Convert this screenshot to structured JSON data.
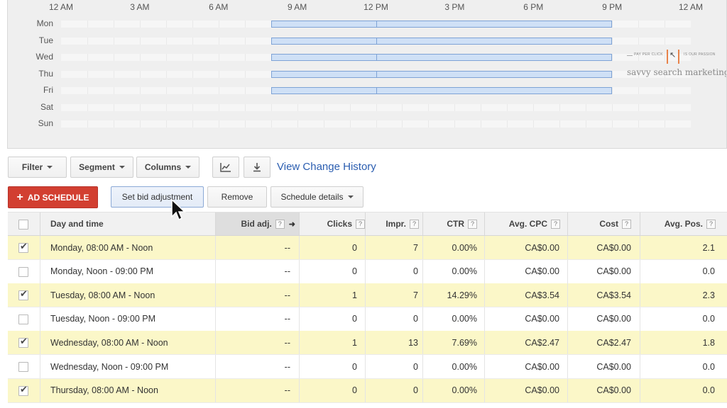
{
  "chart": {
    "hour_labels": [
      "12 AM",
      "3 AM",
      "6 AM",
      "9 AM",
      "12 PM",
      "3 PM",
      "6 PM",
      "9 PM",
      "12 AM"
    ],
    "days": [
      {
        "label": "Mon",
        "scheduled": true
      },
      {
        "label": "Tue",
        "scheduled": true
      },
      {
        "label": "Wed",
        "scheduled": true
      },
      {
        "label": "Thu",
        "scheduled": true
      },
      {
        "label": "Fri",
        "scheduled": true
      },
      {
        "label": "Sat",
        "scheduled": false
      },
      {
        "label": "Sun",
        "scheduled": false
      }
    ],
    "schedule_start_hour": 8,
    "schedule_split_hour": 12,
    "schedule_end_hour": 21,
    "bar_color": "#cfe0f6",
    "bar_border_color": "#7ea3d6"
  },
  "watermark": {
    "tagline_left": "PAY PER CLICK",
    "tagline_right": "IS OUR PASSION",
    "brand": "savvy search marketing",
    "accent_color": "#e8834a"
  },
  "toolbar": {
    "filter_label": "Filter",
    "segment_label": "Segment",
    "columns_label": "Columns",
    "chart_icon": "line-chart-icon",
    "download_icon": "download-icon",
    "change_history_label": "View Change History"
  },
  "actions": {
    "ad_schedule_label": "AD SCHEDULE",
    "set_bid_label": "Set bid adjustment",
    "remove_label": "Remove",
    "schedule_details_label": "Schedule details",
    "primary_color": "#d23f31"
  },
  "table": {
    "headers": {
      "day_time": "Day and time",
      "bid_adj": "Bid adj.",
      "clicks": "Clicks",
      "impr": "Impr.",
      "ctr": "CTR",
      "avg_cpc": "Avg. CPC",
      "cost": "Cost",
      "avg_pos": "Avg. Pos.",
      "help": "?"
    },
    "rows": [
      {
        "checked": true,
        "day_time": "Monday, 08:00 AM - Noon",
        "bid_adj": "--",
        "clicks": "0",
        "impr": "7",
        "ctr": "0.00%",
        "avg_cpc": "CA$0.00",
        "cost": "CA$0.00",
        "avg_pos": "2.1"
      },
      {
        "checked": false,
        "day_time": "Monday, Noon - 09:00 PM",
        "bid_adj": "--",
        "clicks": "0",
        "impr": "0",
        "ctr": "0.00%",
        "avg_cpc": "CA$0.00",
        "cost": "CA$0.00",
        "avg_pos": "0.0"
      },
      {
        "checked": true,
        "day_time": "Tuesday, 08:00 AM - Noon",
        "bid_adj": "--",
        "clicks": "1",
        "impr": "7",
        "ctr": "14.29%",
        "avg_cpc": "CA$3.54",
        "cost": "CA$3.54",
        "avg_pos": "2.3"
      },
      {
        "checked": false,
        "day_time": "Tuesday, Noon - 09:00 PM",
        "bid_adj": "--",
        "clicks": "0",
        "impr": "0",
        "ctr": "0.00%",
        "avg_cpc": "CA$0.00",
        "cost": "CA$0.00",
        "avg_pos": "0.0"
      },
      {
        "checked": true,
        "day_time": "Wednesday, 08:00 AM - Noon",
        "bid_adj": "--",
        "clicks": "1",
        "impr": "13",
        "ctr": "7.69%",
        "avg_cpc": "CA$2.47",
        "cost": "CA$2.47",
        "avg_pos": "1.8"
      },
      {
        "checked": false,
        "day_time": "Wednesday, Noon - 09:00 PM",
        "bid_adj": "--",
        "clicks": "0",
        "impr": "0",
        "ctr": "0.00%",
        "avg_cpc": "CA$0.00",
        "cost": "CA$0.00",
        "avg_pos": "0.0"
      },
      {
        "checked": true,
        "day_time": "Thursday, 08:00 AM - Noon",
        "bid_adj": "--",
        "clicks": "0",
        "impr": "0",
        "ctr": "0.00%",
        "avg_cpc": "CA$0.00",
        "cost": "CA$0.00",
        "avg_pos": "0.0"
      }
    ],
    "selected_row_color": "#fbf7c8",
    "sort_icon": "sort-up-arrow-icon"
  },
  "cursor_icon": "mouse-pointer-icon"
}
